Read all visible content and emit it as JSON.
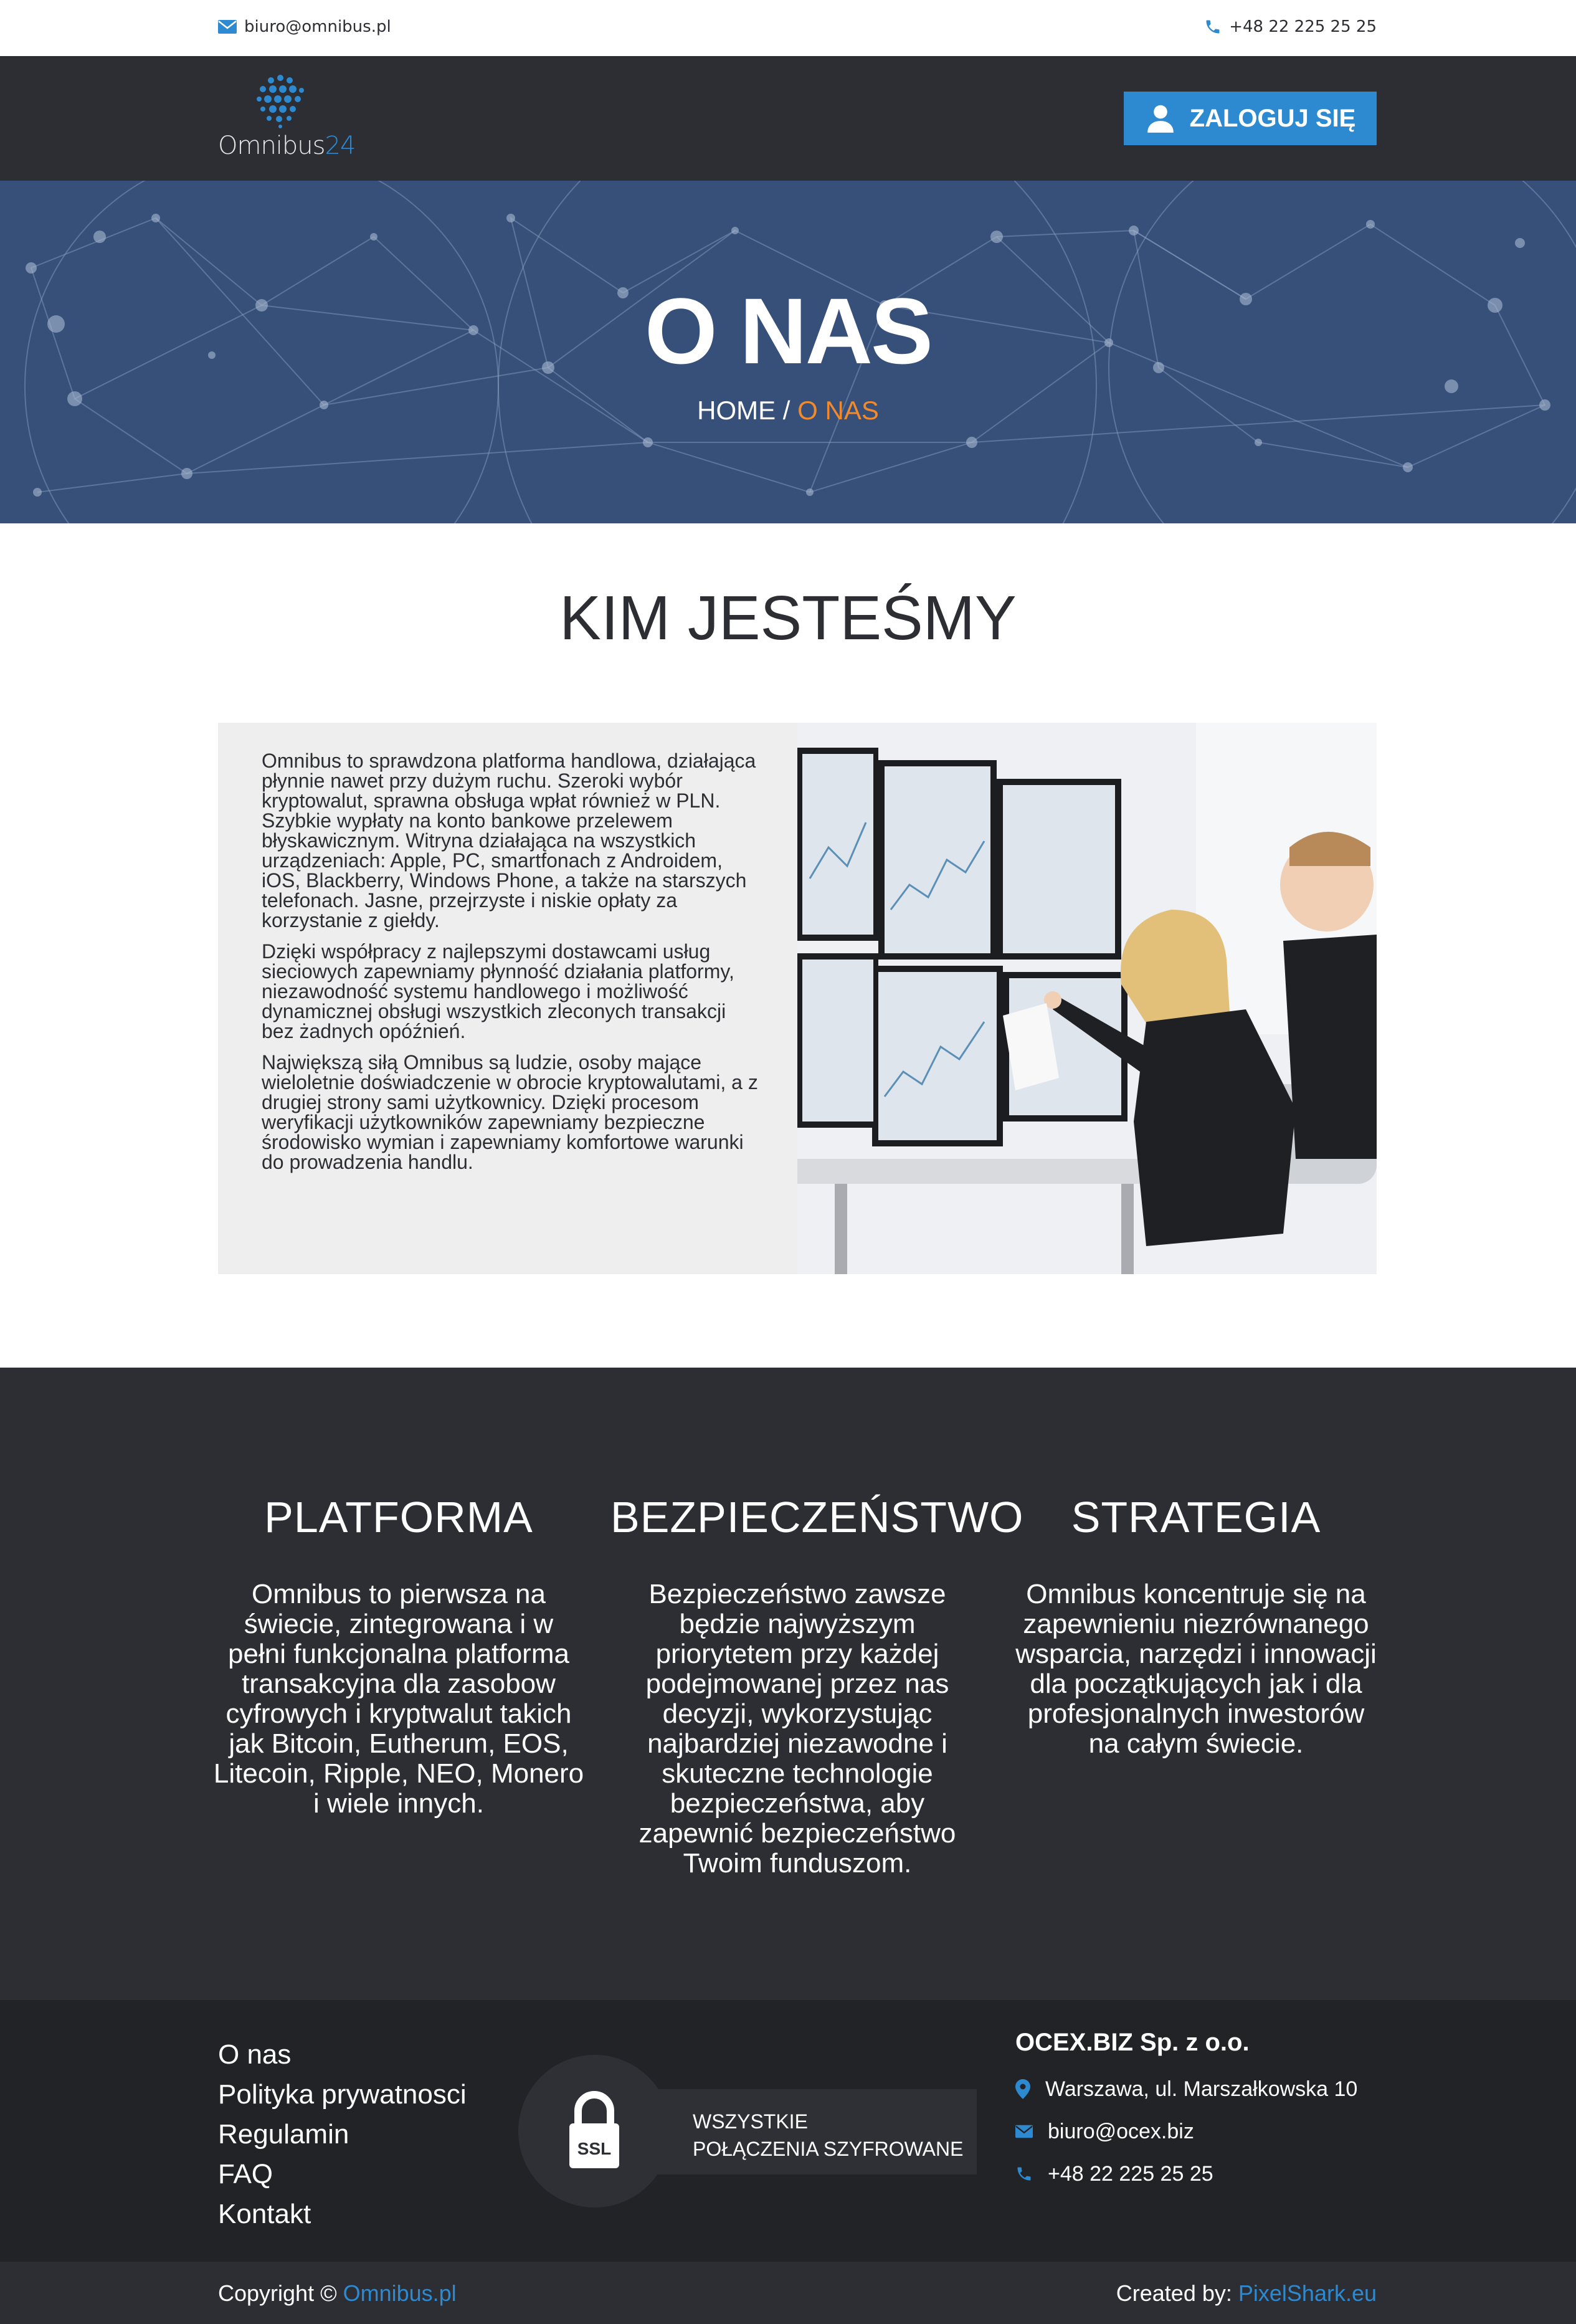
{
  "topbar": {
    "email": "biuro@omnibus.pl",
    "phone": "+48 22 225 25 25"
  },
  "header": {
    "logo_word": "Omnibus",
    "logo_num": "24",
    "login_label": "ZALOGUJ SIĘ"
  },
  "hero": {
    "title": "O NAS",
    "breadcrumb_home": "HOME",
    "breadcrumb_sep": " / ",
    "breadcrumb_current": "O NAS"
  },
  "about": {
    "title": "KIM JESTEŚMY",
    "paragraphs": [
      "Omnibus to sprawdzona platforma handlowa, działająca płynnie nawet przy dużym ruchu. Szeroki wybór kryptowalut, sprawna obsługa wpłat również w PLN. Szybkie wypłaty na konto bankowe przelewem błyskawicznym. Witryna działająca na wszystkich urządzeniach: Apple, PC, smartfonach z Androidem, iOS, Blackberry, Windows Phone, a także na starszych telefonach. Jasne, przejrzyste i niskie opłaty za korzystanie z giełdy.",
      "Dzięki współpracy z najlepszymi dostawcami usług sieciowych zapewniamy płynność działania platformy, niezawodność systemu handlowego i możliwość dynamicznej obsługi wszystkich zleconych transakcji bez żadnych opóźnień.",
      "Największą siłą Omnibus są ludzie, osoby mające wieloletnie doświadczenie w obrocie kryptowalutami, a z drugiej strony sami użytkownicy. Dzięki procesom weryfikacji użytkowników zapewniamy bezpieczne środowisko wymian i zapewniamy komfortowe warunki do prowadzenia handlu."
    ]
  },
  "features": [
    {
      "title": "PLATFORMA",
      "text": "Omnibus to pierwsza na świecie, zintegrowana i w pełni funkcjonalna platforma transakcyjna dla zasobow cyfrowych i kryptwalut takich jak Bitcoin, Eutherum, EOS, Litecoin, Ripple, NEO, Monero i wiele innych."
    },
    {
      "title": "BEZPIECZEŃSTWO",
      "text": "Bezpieczeństwo zawsze będzie najwyższym priorytetem przy każdej podejmowanej przez nas decyzji, wykorzystując najbardziej niezawodne i skuteczne technologie bezpieczeństwa, aby zapewnić bezpieczeństwo Twoim funduszom."
    },
    {
      "title": "STRATEGIA",
      "text": "Omnibus koncentruje się na zapewnieniu niezrównanego wsparcia, narzędzi i innowacji dla początkujących jak i dla profesjonalnych inwestorów na całym świecie."
    }
  ],
  "footer": {
    "links": [
      "O nas",
      "Polityka prywatnosci",
      "Regulamin",
      "FAQ",
      "Kontakt"
    ],
    "ssl_badge": "SSL",
    "ssl_line1": "WSZYSTKIE",
    "ssl_line2": "POŁĄCZENIA SZYFROWANE",
    "company": "OCEX.BIZ Sp. z o.o.",
    "address": "Warszawa, ul. Marszałkowska 10",
    "email": "biuro@ocex.biz",
    "phone": "+48 22 225 25 25"
  },
  "copybar": {
    "copyright_prefix": "Copyright © ",
    "copyright_link": "Omnibus.pl",
    "created_prefix": "Created by: ",
    "created_link": "PixelShark.eu"
  },
  "colors": {
    "accent": "#2e8ad0",
    "orange": "#f08a2c",
    "dark": "#2d2e33",
    "footer": "#222326",
    "hero": "#36507a"
  }
}
